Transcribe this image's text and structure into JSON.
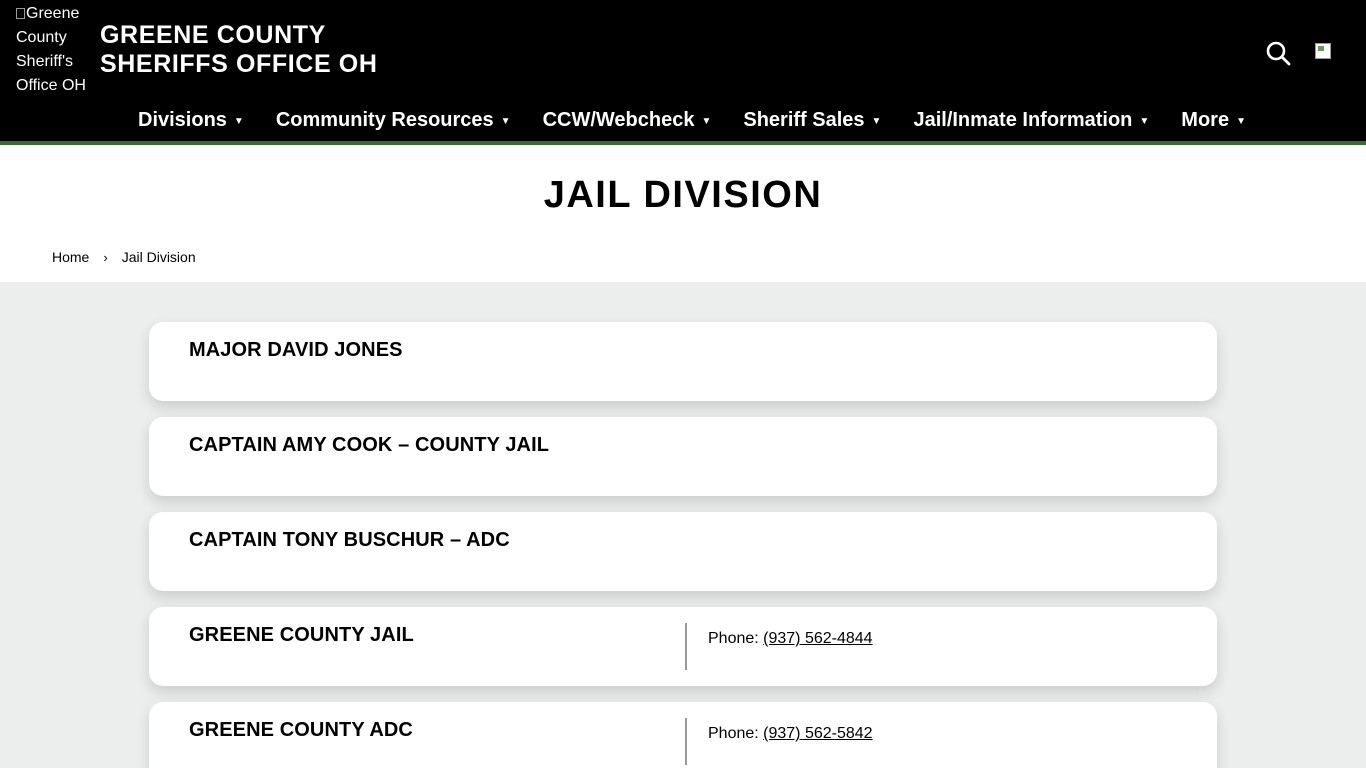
{
  "header": {
    "logo_alt": "Greene County Sheriff's Office OH",
    "site_title_line1": "GREENE COUNTY",
    "site_title_line2": "SHERIFFS OFFICE OH"
  },
  "nav": {
    "items": [
      {
        "label": "Divisions"
      },
      {
        "label": "Community Resources"
      },
      {
        "label": "CCW/Webcheck"
      },
      {
        "label": "Sheriff Sales"
      },
      {
        "label": "Jail/Inmate Information"
      },
      {
        "label": "More"
      }
    ]
  },
  "page": {
    "title": "JAIL DIVISION",
    "breadcrumb": {
      "home": "Home",
      "separator": "›",
      "current": "Jail Division"
    }
  },
  "cards": [
    {
      "title": "MAJOR DAVID JONES"
    },
    {
      "title": "CAPTAIN AMY COOK – COUNTY JAIL"
    },
    {
      "title": "CAPTAIN TONY BUSCHUR – ADC"
    },
    {
      "title": "GREENE COUNTY JAIL",
      "phone_label": "Phone: ",
      "phone": "(937) 562-4844"
    },
    {
      "title": "GREENE COUNTY ADC",
      "phone_label": "Phone: ",
      "phone": "(937) 562-5842"
    }
  ],
  "colors": {
    "header_bg": "#000000",
    "accent_green": "#3a6b35",
    "page_bg": "#eceeee"
  },
  "icons": {
    "search": "search-icon",
    "language": "language-flag-image"
  }
}
